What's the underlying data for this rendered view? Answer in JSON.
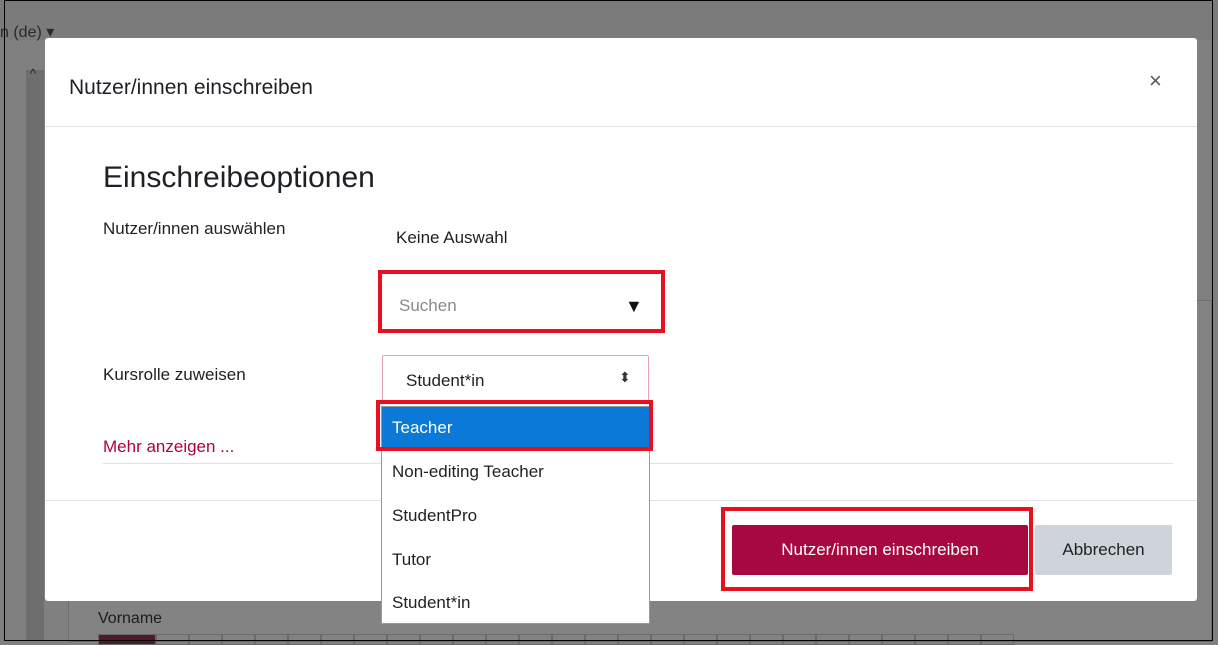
{
  "background": {
    "language_label": "n (de)",
    "language_caret": "▾",
    "scroll_up_icon": "^",
    "vorname_label": "Vorname"
  },
  "modal": {
    "title": "Nutzer/innen einschreiben",
    "close_icon": "×",
    "section_title": "Einschreibeoptionen",
    "select_users_label": "Nutzer/innen auswählen",
    "selection_value": "Keine Auswahl",
    "search_placeholder": "Suchen",
    "search_arrow_icon": "▼",
    "role_label": "Kursrolle zuweisen",
    "role_selected": "Student*in",
    "role_caret_icon": "⬍",
    "more_link": "Mehr anzeigen ...",
    "enrol_button": "Nutzer/innen einschreiben",
    "cancel_button": "Abbrechen"
  },
  "role_options": [
    "Teacher",
    "Non-editing Teacher",
    "StudentPro",
    "Tutor",
    "Student*in"
  ],
  "colors": {
    "primary": "#a6083f",
    "highlight": "#e8101e",
    "selected_option": "#0a79d8",
    "link": "#b3003b"
  }
}
